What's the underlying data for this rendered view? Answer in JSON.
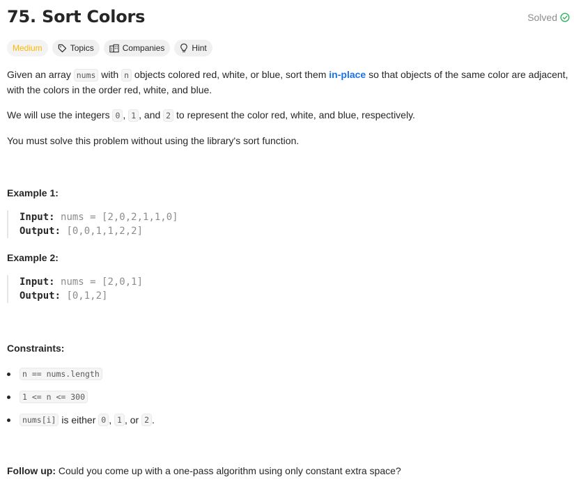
{
  "problem": {
    "title": "75. Sort Colors",
    "status": "Solved",
    "colors": {
      "difficulty": "#ffb800",
      "solved_icon": "#2db55d",
      "link": "#1a73e8"
    }
  },
  "tags": {
    "difficulty": "Medium",
    "topics": "Topics",
    "companies": "Companies",
    "hint": "Hint"
  },
  "description": {
    "p1_a": "Given an array ",
    "p1_code1": "nums",
    "p1_b": " with ",
    "p1_code2": "n",
    "p1_c": " objects colored red, white, or blue, sort them ",
    "p1_link": "in-place",
    "p1_d": " so that objects of the same color are adjacent,",
    "p1_e": "with the colors in the order red, white, and blue.",
    "p2_a": "We will use the integers ",
    "p2_c0": "0",
    "p2_sep1": ", ",
    "p2_c1": "1",
    "p2_sep2": ", and ",
    "p2_c2": "2",
    "p2_b": " to represent the color red, white, and blue, respectively.",
    "p3": "You must solve this problem without using the library's sort function."
  },
  "examples": [
    {
      "title": "Example 1:",
      "input_label": "Input:",
      "input": "nums = [2,0,2,1,1,0]",
      "output_label": "Output:",
      "output": "[0,0,1,1,2,2]"
    },
    {
      "title": "Example 2:",
      "input_label": "Input:",
      "input": "nums = [2,0,1]",
      "output_label": "Output:",
      "output": "[0,1,2]"
    }
  ],
  "constraints": {
    "title": "Constraints:",
    "c1": "n == nums.length",
    "c2": "1 <= n <= 300",
    "c3_code": "nums[i]",
    "c3_a": " is either ",
    "c3_v0": "0",
    "c3_s1": ", ",
    "c3_v1": "1",
    "c3_s2": ", or ",
    "c3_v2": "2",
    "c3_end": "."
  },
  "followup": {
    "label": "Follow up:",
    "text": " Could you come up with a one-pass algorithm using only constant extra space?"
  }
}
